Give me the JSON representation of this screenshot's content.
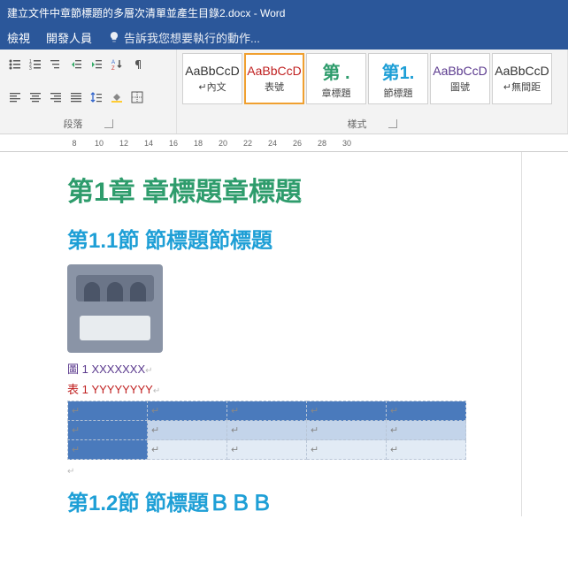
{
  "title": "建立文件中章節標題的多層次清單並產生目錄2.docx - Word",
  "menu": {
    "view": "檢視",
    "dev": "開發人員",
    "tellme": "告訴我您想要執行的動作..."
  },
  "groups": {
    "paragraph": "段落",
    "styles": "樣式"
  },
  "ruler_ticks": [
    "8",
    "10",
    "12",
    "14",
    "16",
    "18",
    "20",
    "22",
    "24",
    "26",
    "28",
    "30"
  ],
  "styles": [
    {
      "preview": "AaBbCcD",
      "name": "↵內文",
      "color": "#333"
    },
    {
      "preview": "AaBbCcD",
      "name": "表號",
      "color": "#c02020",
      "selected": true
    },
    {
      "preview": "第 .",
      "name": "章標題",
      "color": "#2e9c6c",
      "bold": true,
      "big": true
    },
    {
      "preview": "第1.",
      "name": "節標題",
      "color": "#1e9fd6",
      "bold": true,
      "big": true
    },
    {
      "preview": "AaBbCcD",
      "name": "圖號",
      "color": "#5b3a8e"
    },
    {
      "preview": "AaBbCcD",
      "name": "↵無間距",
      "color": "#333"
    }
  ],
  "doc": {
    "h1": "第1章 章標題章標題",
    "h2a": "第1.1節 節標題節標題",
    "fig_caption": "圖 1 XXXXXXX",
    "tbl_caption": "表 1 YYYYYYYY",
    "h2b": "第1.2節 節標題ＢＢＢ"
  },
  "cellmark": "↵"
}
